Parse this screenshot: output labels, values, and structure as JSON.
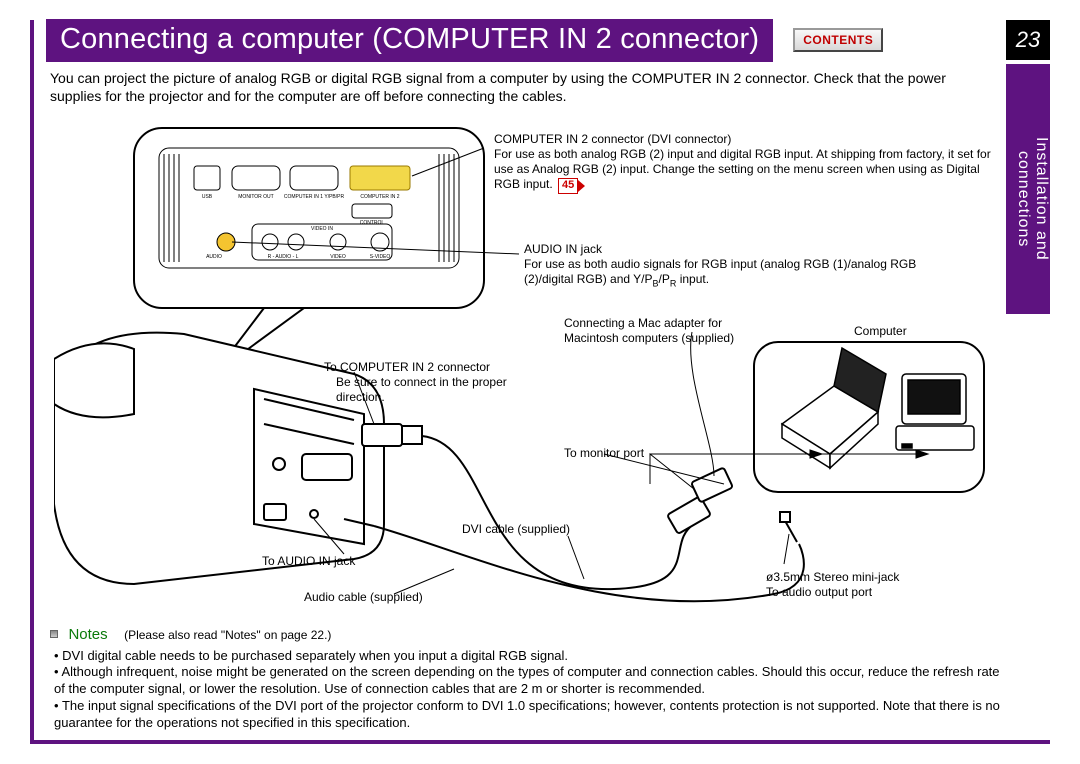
{
  "header": {
    "title": "Connecting a computer (COMPUTER IN 2 connector)",
    "contents_label": "CONTENTS",
    "page_number": "23",
    "section_tab": "Installation and\nconnections"
  },
  "intro": "You can project the picture of analog RGB or digital RGB signal from a computer by using the COMPUTER IN 2 connector. Check that the power supplies for the projector and for the computer are off before connecting the cables.",
  "callouts": {
    "comp_in2_title": "COMPUTER IN 2 connector (DVI connector)",
    "comp_in2_body": "For use as both analog RGB (2) input and digital RGB input. At shipping from factory, it set for use as Analog RGB (2) input. Change the setting on the menu screen when using as Digital RGB input.",
    "xref_45": "45",
    "audio_title": "AUDIO IN jack",
    "audio_body_a": "For use as both audio signals for RGB input (analog RGB (1)/analog RGB (2)/digital RGB) and Y/P",
    "audio_body_b": "/P",
    "audio_body_c": " input.",
    "mac_adapter": "Connecting a Mac adapter for Macintosh computers (supplied)",
    "computer_label": "Computer",
    "to_comp_in2": "To COMPUTER IN 2 connector",
    "proper_dir": "Be sure to connect in the proper direction.",
    "to_monitor": "To monitor port",
    "dvi_cable": "DVI cable (supplied)",
    "to_audio_in": "To AUDIO IN jack",
    "audio_cable": "Audio cable (supplied)",
    "mini_jack": "ø3.5mm Stereo mini-jack",
    "to_audio_out": "To audio output port"
  },
  "panel_labels": {
    "usb": "USB",
    "monitor_out": "MONITOR OUT",
    "computer_in1": "COMPUTER IN 1 Y/PB/PR",
    "computer_in2": "COMPUTER IN 2",
    "control": "CONTROL",
    "audio": "AUDIO",
    "r_audio_l": "R - AUDIO - L",
    "video_in": "VIDEO IN",
    "video": "VIDEO",
    "svideo": "S-VIDEO"
  },
  "notes": {
    "heading": "Notes",
    "sub": "(Please also read \"Notes\" on page 22.)",
    "items": [
      "DVI digital cable needs to be purchased separately when you input a digital RGB signal.",
      "Although infrequent, noise might be generated on the screen depending on the types of computer and connection cables. Should this occur, reduce the refresh rate of the computer signal, or lower the resolution. Use of connection cables that are 2 m or shorter is recommended.",
      "The input signal specifications of the DVI port of the projector conform to DVI 1.0 specifications; however, contents protection is not supported. Note that there is no guarantee for the operations not specified in this specification."
    ]
  }
}
